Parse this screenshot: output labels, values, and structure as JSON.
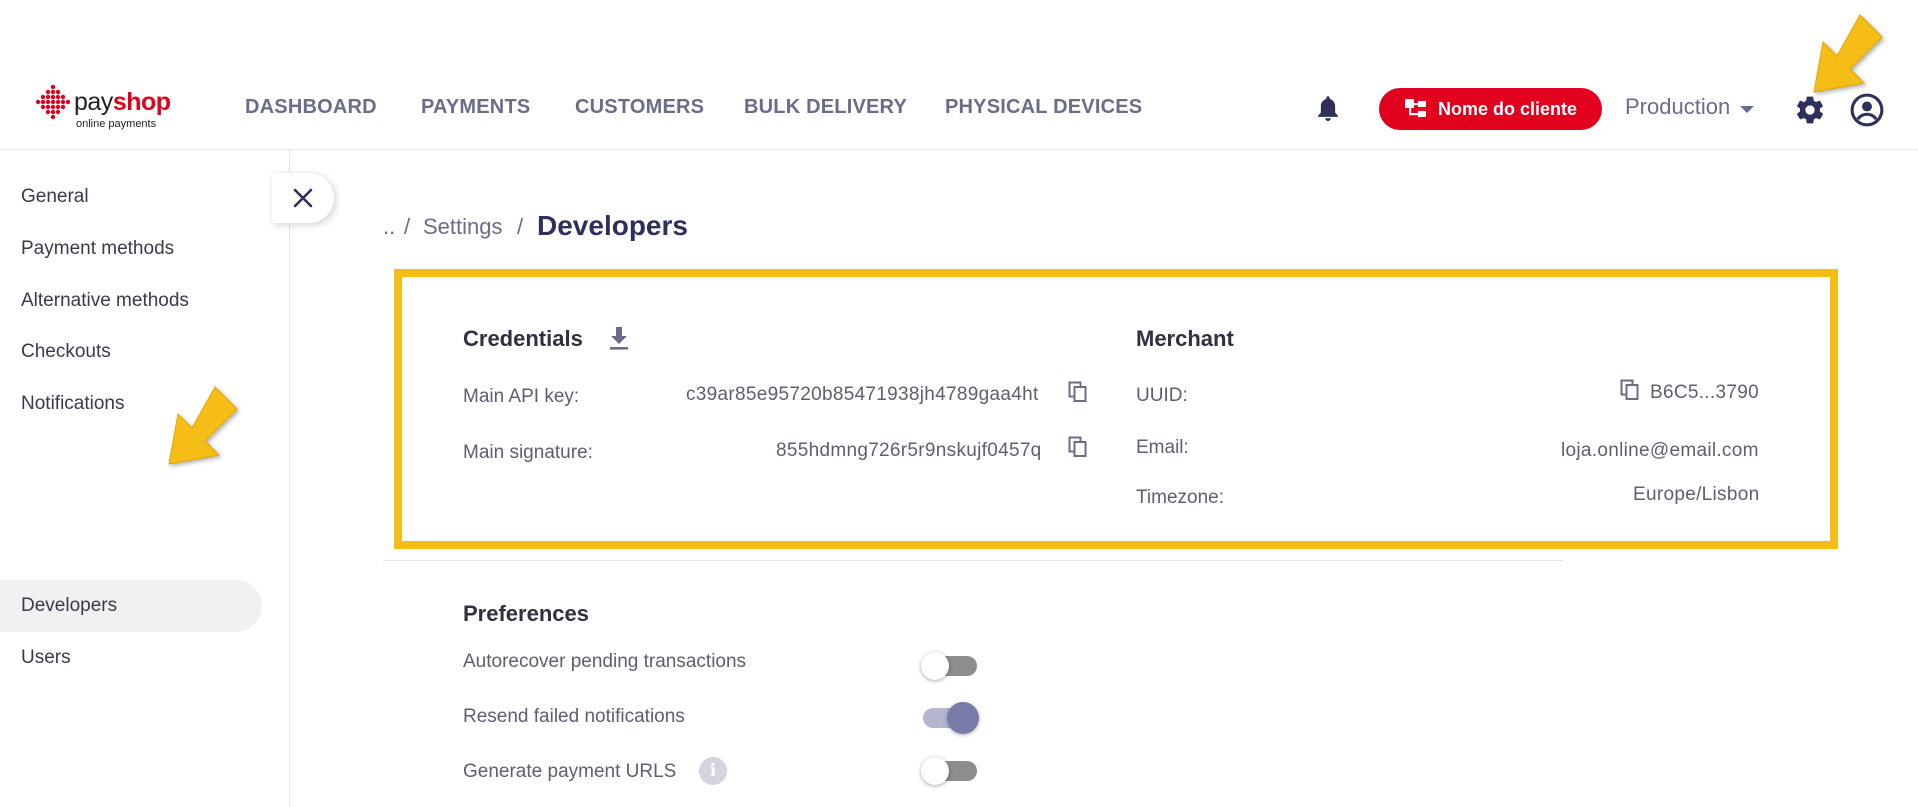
{
  "header": {
    "logo": {
      "brand_pay": "pay",
      "brand_shop": "shop",
      "tagline": "online payments"
    },
    "nav": [
      "DASHBOARD",
      "PAYMENTS",
      "CUSTOMERS",
      "BULK DELIVERY",
      "PHYSICAL DEVICES"
    ],
    "client_button": "Nome do cliente",
    "environment": "Production",
    "icons": [
      "bell-icon",
      "hierarchy-icon",
      "gear-icon",
      "account-icon"
    ]
  },
  "sidebar": {
    "items": [
      "General",
      "Payment methods",
      "Alternative methods",
      "Checkouts",
      "Notifications",
      "Developers",
      "Users"
    ],
    "active": "Developers"
  },
  "breadcrumb": {
    "up": "..",
    "sep": "/",
    "parent": "Settings",
    "current": "Developers"
  },
  "credentials": {
    "title": "Credentials",
    "api_key_label": "Main API key:",
    "api_key_value": "c39ar85e95720b85471938jh4789gaa4ht",
    "signature_label": "Main signature:",
    "signature_value": "855hdmng726r5r9nskujf0457q"
  },
  "merchant": {
    "title": "Merchant",
    "uuid_label": "UUID:",
    "uuid_value": "B6C5...3790",
    "email_label": "Email:",
    "email_value": "loja.online@email.com",
    "timezone_label": "Timezone:",
    "timezone_value": "Europe/Lisbon"
  },
  "preferences": {
    "title": "Preferences",
    "items": [
      {
        "label": "Autorecover pending transactions",
        "enabled": false
      },
      {
        "label": "Resend failed notifications",
        "enabled": true
      },
      {
        "label": "Generate payment URLS",
        "enabled": false,
        "info_icon": "i"
      }
    ]
  },
  "colors": {
    "brand_red": "#e1001e",
    "highlight": "#f6bd16",
    "accent": "#7a7aa8",
    "nav_text": "#6b6c8a"
  }
}
